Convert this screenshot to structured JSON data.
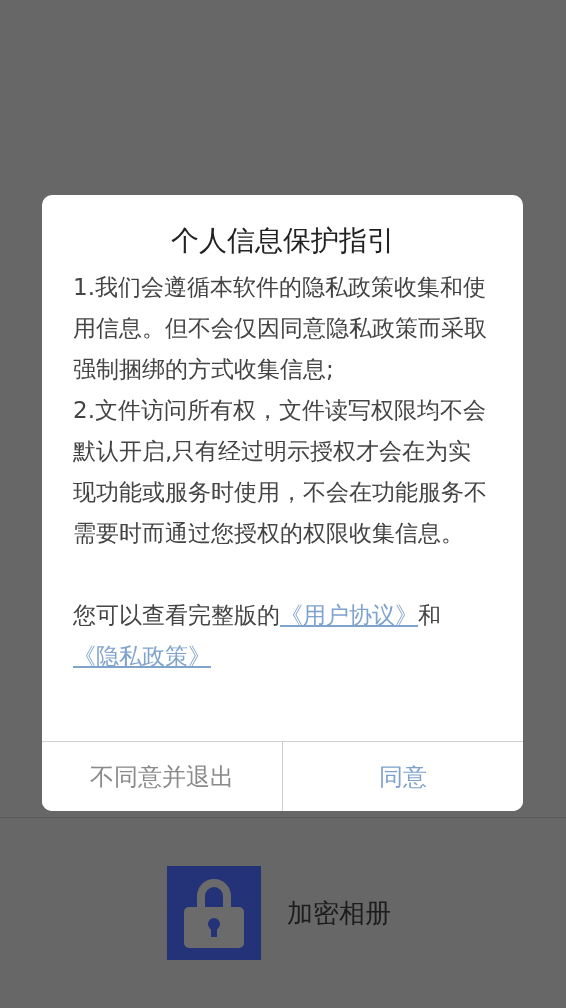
{
  "app": {
    "name": "加密相册"
  },
  "dialog": {
    "title": "个人信息保护指引",
    "paragraphs": [
      "1.我们会遵循本软件的隐私政策收集和使用信息。但不会仅因同意隐私政策而采取强制捆绑的方式收集信息;",
      "2.文件访问所有权，文件读写权限均不会默认开启,只有经过明示授权才会在为实现功能或服务时使用，不会在功能服务不需要时而通过您授权的权限收集信息。"
    ],
    "notice": {
      "text": "您可以查看完整版的",
      "link_1": "《用户协议》",
      "joiner": "和",
      "link_2": "《隐私政策》"
    },
    "buttons": [
      {
        "label": "不同意并退出",
        "kind": "decline"
      },
      {
        "label": "同意",
        "kind": "accept"
      }
    ]
  }
}
